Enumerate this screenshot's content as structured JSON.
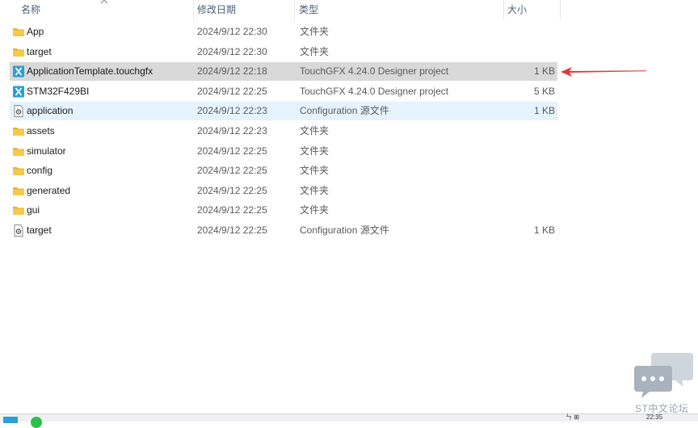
{
  "columns": {
    "name": "名称",
    "date": "修改日期",
    "type": "类型",
    "size": "大小"
  },
  "rows": [
    {
      "icon": "folder-icon",
      "name": "App",
      "date": "2024/9/12 22:30",
      "type": "文件夹",
      "size": ""
    },
    {
      "icon": "folder-icon",
      "name": "target",
      "date": "2024/9/12 22:30",
      "type": "文件夹",
      "size": ""
    },
    {
      "icon": "touchgfx-icon",
      "name": "ApplicationTemplate.touchgfx",
      "date": "2024/9/12 22:18",
      "type": "TouchGFX 4.24.0 Designer project",
      "size": "1 KB"
    },
    {
      "icon": "touchgfx-icon",
      "name": "STM32F429BI",
      "date": "2024/9/12 22:25",
      "type": "TouchGFX 4.24.0 Designer project",
      "size": "5 KB"
    },
    {
      "icon": "config-file-icon",
      "name": "application",
      "date": "2024/9/12 22:23",
      "type": "Configuration 源文件",
      "size": "1 KB"
    },
    {
      "icon": "folder-icon",
      "name": "assets",
      "date": "2024/9/12 22:23",
      "type": "文件夹",
      "size": ""
    },
    {
      "icon": "folder-icon",
      "name": "simulator",
      "date": "2024/9/12 22:25",
      "type": "文件夹",
      "size": ""
    },
    {
      "icon": "folder-icon",
      "name": "config",
      "date": "2024/9/12 22:25",
      "type": "文件夹",
      "size": ""
    },
    {
      "icon": "folder-icon",
      "name": "generated",
      "date": "2024/9/12 22:25",
      "type": "文件夹",
      "size": ""
    },
    {
      "icon": "folder-icon",
      "name": "gui",
      "date": "2024/9/12 22:25",
      "type": "文件夹",
      "size": ""
    },
    {
      "icon": "config-file-icon",
      "name": "target",
      "date": "2024/9/12 22:25",
      "type": "Configuration 源文件",
      "size": "1 KB"
    }
  ],
  "selected_row": 2,
  "hover_row": 4,
  "colors": {
    "selected": "#d9d9d9",
    "hover": "#e5f3ff",
    "folder": "#f7c948",
    "touchgfx": "#2a9fd6",
    "arrow": "#e53935"
  },
  "taskbar": {
    "clock": "22:35",
    "tray": "ㄣ  ⊞"
  },
  "watermark": {
    "text": "ST中文论坛"
  }
}
